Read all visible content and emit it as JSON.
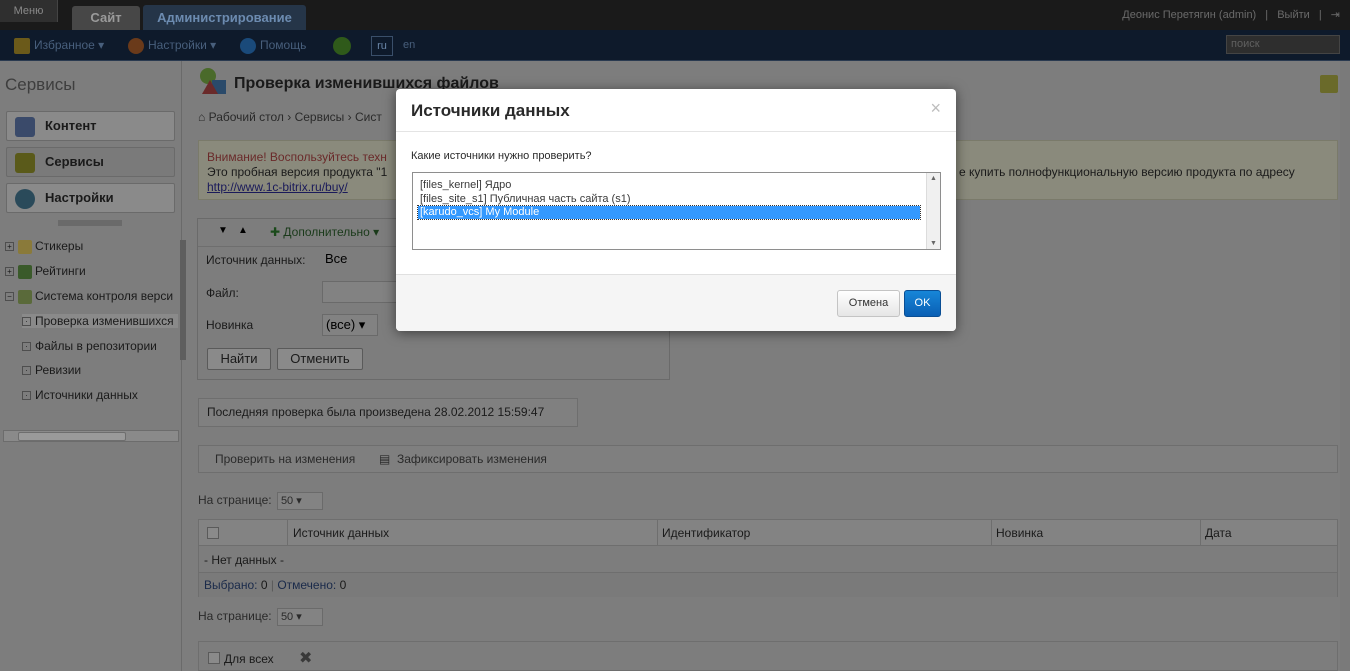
{
  "topbar": {
    "menu_label": "Меню",
    "tab_site": "Сайт",
    "tab_admin": "Администрирование",
    "user_name": "Деонис Перетягин (admin)",
    "logout": "Выйти"
  },
  "toolbar": {
    "favorites": "Избранное",
    "settings": "Настройки",
    "help": "Помощь",
    "lang_ru": "ru",
    "lang_en": "en",
    "search_placeholder": "поиск"
  },
  "sidebar": {
    "title": "Сервисы",
    "buttons": [
      {
        "label": "Контент"
      },
      {
        "label": "Сервисы"
      },
      {
        "label": "Настройки"
      }
    ],
    "tree": [
      {
        "label": "Стикеры"
      },
      {
        "label": "Рейтинги"
      },
      {
        "label": "Система контроля верси"
      },
      {
        "label": "Проверка изменившихся"
      },
      {
        "label": "Файлы в репозитории"
      },
      {
        "label": "Ревизии"
      },
      {
        "label": "Источники данных"
      }
    ]
  },
  "page": {
    "title": "Проверка изменившихся файлов",
    "breadcrumb": "Рабочий стол  ›  Сервисы  ›  Сист",
    "alert_warning": "Внимание! Воспользуйтесь техн",
    "alert_line2": "Это пробная версия продукта \"1",
    "alert_link": "http://www.1c-bitrix.ru/buy/",
    "alert_right": "е купить полнофункциональную версию продукта по адресу"
  },
  "filter": {
    "extra_label": "Дополнительно",
    "source_label": "Источник данных:",
    "source_value": "Все",
    "file_label": "Файл:",
    "new_label": "Новинка",
    "new_value": "(все)",
    "find_button": "Найти",
    "cancel_button": "Отменить"
  },
  "last_check": "Последняя проверка была произведена 28.02.2012 15:59:47",
  "actions": {
    "check": "Проверить на изменения",
    "commit": "Зафиксировать изменения"
  },
  "perpage": {
    "label": "На странице:",
    "value": "50"
  },
  "grid": {
    "columns": [
      "Источник данных",
      "Идентификатор",
      "Новинка",
      "Дата"
    ],
    "nodata": "- Нет данных -",
    "selected_label": "Выбрано:",
    "selected_count": "0",
    "marked_label": "Отмечено:",
    "marked_count": "0"
  },
  "bottom": {
    "for_all": "Для всех"
  },
  "dialog": {
    "title": "Источники данных",
    "question": "Какие источники нужно проверить?",
    "options": [
      {
        "label": "[files_kernel] Ядро",
        "selected": false
      },
      {
        "label": "[files_site_s1] Публичная часть сайта (s1)",
        "selected": false
      },
      {
        "label": "[karudo_vcs] My Module",
        "selected": true
      }
    ],
    "cancel": "Отмена",
    "ok": "OK"
  }
}
